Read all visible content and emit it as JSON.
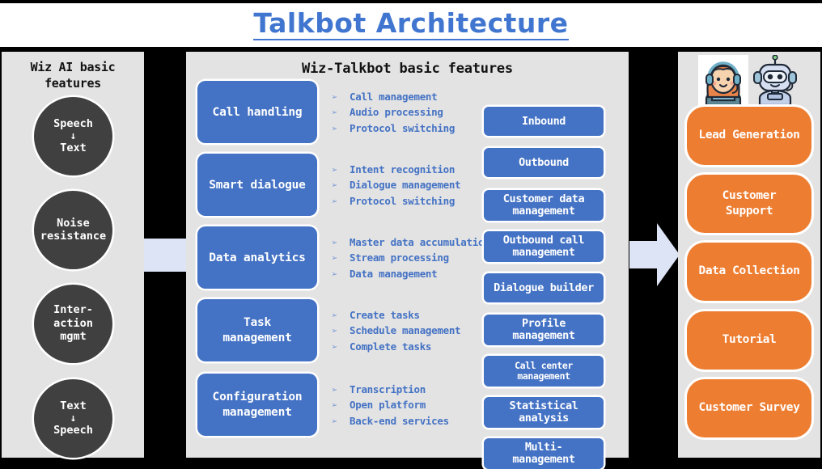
{
  "title": "Talkbot Architecture",
  "accent_colors": {
    "title_blue": "#4176D0",
    "feature_blue": "#4472C4",
    "usecase_orange": "#ED7D31",
    "circle_dark": "#404040",
    "panel_bg": "#E3E3E3",
    "connector_blue": "#DCE4F5",
    "page_bg": "#000000"
  },
  "left_panel": {
    "heading_line1": "Wiz AI basic",
    "heading_line2": "features",
    "circles": [
      {
        "line1": "Speech",
        "arrow": "↓",
        "line2": "Text"
      },
      {
        "line1": "Noise",
        "line2": "resistance"
      },
      {
        "line1": "Inter-",
        "line2": "action",
        "line3": "mgmt"
      },
      {
        "line1": "Text",
        "arrow": "↓",
        "line2": "Speech"
      }
    ]
  },
  "middle_panel": {
    "heading": "Wiz-Talkbot basic features",
    "bullet_mark": "➢",
    "features": [
      {
        "title_line1": "Call handling",
        "bullets": [
          "Call management",
          "Audio processing",
          "Protocol switching"
        ]
      },
      {
        "title_line1": "Smart dialogue",
        "bullets": [
          "Intent recognition",
          "Dialogue management",
          "Protocol switching"
        ]
      },
      {
        "title_line1": "Data analytics",
        "bullets": [
          "Master data accumulation",
          "Stream processing",
          "Data management"
        ]
      },
      {
        "title_line1": "Task",
        "title_line2": "management",
        "bullets": [
          "Create tasks",
          "Schedule management",
          "Complete tasks"
        ]
      },
      {
        "title_line1": "Configuration",
        "title_line2": "management",
        "bullets": [
          "Transcription",
          "Open platform",
          "Back-end services"
        ]
      }
    ],
    "modules": [
      {
        "line1": "Inbound"
      },
      {
        "line1": "Outbound"
      },
      {
        "line1": "Customer data",
        "line2": "management"
      },
      {
        "line1": "Outbound call",
        "line2": "management"
      },
      {
        "line1": "Dialogue builder"
      },
      {
        "line1": "Profile",
        "line2": "management"
      },
      {
        "line1": "Call center",
        "line2": "management"
      },
      {
        "line1": "Statistical",
        "line2": "analysis"
      },
      {
        "line1": "Multi-",
        "line2": "management"
      }
    ]
  },
  "right_panel": {
    "illustration_name": "agent-and-robot-illustration",
    "use_cases": [
      {
        "line1": "Lead Generation"
      },
      {
        "line1": "Customer",
        "line2": "Support"
      },
      {
        "line1": "Data Collection"
      },
      {
        "line1": "Tutorial"
      },
      {
        "line1": "Customer Survey"
      }
    ]
  }
}
